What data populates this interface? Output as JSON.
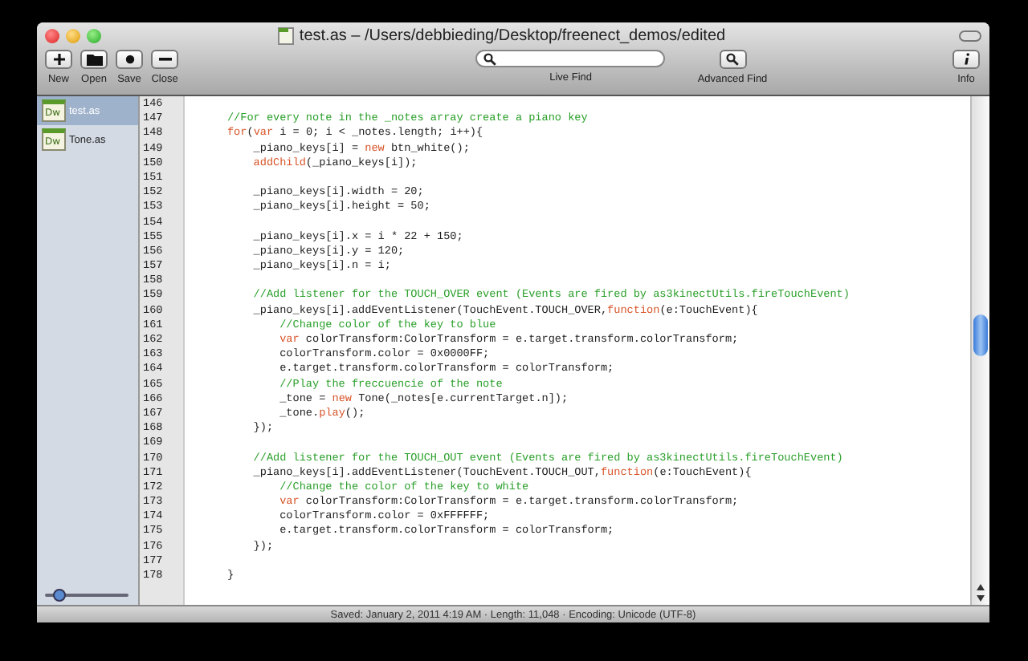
{
  "window": {
    "title": "test.as – /Users/debbieding/Desktop/freenect_demos/edited"
  },
  "toolbar": {
    "buttons": [
      {
        "kind": "new",
        "label": "New"
      },
      {
        "kind": "open",
        "label": "Open"
      },
      {
        "kind": "save",
        "label": "Save"
      },
      {
        "kind": "close",
        "label": "Close"
      }
    ],
    "search": {
      "label": "Live Find"
    },
    "advanced_find": {
      "label": "Advanced Find"
    },
    "info": {
      "label": "Info"
    }
  },
  "sidebar": {
    "items": [
      {
        "icon_text": "Dw",
        "label": "test.as",
        "selected": true
      },
      {
        "icon_text": "Dw",
        "label": "Tone.as",
        "selected": false
      }
    ],
    "slider": {
      "level": 0.15
    }
  },
  "editor": {
    "lines": [
      {
        "n": "146"
      },
      {
        "n": "147",
        "code": [
          {
            "kind": "comment",
            "text": "      //For every note in the _notes array create a piano key"
          }
        ]
      },
      {
        "n": "148",
        "code": [
          {
            "kind": "keyword",
            "text": "      for"
          },
          {
            "kind": "plain",
            "text": "("
          },
          {
            "kind": "keyword",
            "text": "var"
          },
          {
            "kind": "plain",
            "text": " i = 0; i < _notes.length; i++){"
          }
        ]
      },
      {
        "n": "149",
        "code": [
          {
            "kind": "plain",
            "text": "          _piano_keys[i] = "
          },
          {
            "kind": "keyword",
            "text": "new"
          },
          {
            "kind": "plain",
            "text": " btn_white();"
          }
        ]
      },
      {
        "n": "150",
        "code": [
          {
            "kind": "keyword",
            "text": "          addChild"
          },
          {
            "kind": "plain",
            "text": "(_piano_keys[i]);"
          }
        ]
      },
      {
        "n": "151"
      },
      {
        "n": "152",
        "code": [
          {
            "kind": "plain",
            "text": "          _piano_keys[i].width = 20;"
          }
        ]
      },
      {
        "n": "153",
        "code": [
          {
            "kind": "plain",
            "text": "          _piano_keys[i].height = 50;"
          }
        ]
      },
      {
        "n": "154"
      },
      {
        "n": "155",
        "code": [
          {
            "kind": "plain",
            "text": "          _piano_keys[i].x = i * 22 + 150;"
          }
        ]
      },
      {
        "n": "156",
        "code": [
          {
            "kind": "plain",
            "text": "          _piano_keys[i].y = 120;"
          }
        ]
      },
      {
        "n": "157",
        "code": [
          {
            "kind": "plain",
            "text": "          _piano_keys[i].n = i;"
          }
        ]
      },
      {
        "n": "158"
      },
      {
        "n": "159",
        "code": [
          {
            "kind": "comment",
            "text": "          //Add listener for the TOUCH_OVER event (Events are fired by as3kinectUtils.fireTouchEvent)"
          }
        ]
      },
      {
        "n": "160",
        "code": [
          {
            "kind": "plain",
            "text": "          _piano_keys[i].addEventListener(TouchEvent.TOUCH_OVER,"
          },
          {
            "kind": "keyword",
            "text": "function"
          },
          {
            "kind": "plain",
            "text": "(e:TouchEvent){"
          }
        ]
      },
      {
        "n": "161",
        "code": [
          {
            "kind": "comment",
            "text": "              //Change color of the key to blue"
          }
        ]
      },
      {
        "n": "162",
        "code": [
          {
            "kind": "keyword",
            "text": "              var"
          },
          {
            "kind": "plain",
            "text": " colorTransform:ColorTransform = e.target.transform.colorTransform;"
          }
        ]
      },
      {
        "n": "163",
        "code": [
          {
            "kind": "plain",
            "text": "              colorTransform.color = 0x0000FF;"
          }
        ]
      },
      {
        "n": "164",
        "code": [
          {
            "kind": "plain",
            "text": "              e.target.transform.colorTransform = colorTransform;"
          }
        ]
      },
      {
        "n": "165",
        "code": [
          {
            "kind": "comment",
            "text": "              //Play the freccuencie of the note"
          }
        ]
      },
      {
        "n": "166",
        "code": [
          {
            "kind": "plain",
            "text": "              _tone = "
          },
          {
            "kind": "keyword",
            "text": "new"
          },
          {
            "kind": "plain",
            "text": " Tone(_notes[e.currentTarget.n]);"
          }
        ]
      },
      {
        "n": "167",
        "code": [
          {
            "kind": "plain",
            "text": "              _tone."
          },
          {
            "kind": "keyword",
            "text": "play"
          },
          {
            "kind": "plain",
            "text": "();"
          }
        ]
      },
      {
        "n": "168",
        "code": [
          {
            "kind": "plain",
            "text": "          });"
          }
        ]
      },
      {
        "n": "169"
      },
      {
        "n": "170",
        "code": [
          {
            "kind": "comment",
            "text": "          //Add listener for the TOUCH_OUT event (Events are fired by as3kinectUtils.fireTouchEvent)"
          }
        ]
      },
      {
        "n": "171",
        "code": [
          {
            "kind": "plain",
            "text": "          _piano_keys[i].addEventListener(TouchEvent.TOUCH_OUT,"
          },
          {
            "kind": "keyword",
            "text": "function"
          },
          {
            "kind": "plain",
            "text": "(e:TouchEvent){"
          }
        ]
      },
      {
        "n": "172",
        "code": [
          {
            "kind": "comment",
            "text": "              //Change the color of the key to white"
          }
        ]
      },
      {
        "n": "173",
        "code": [
          {
            "kind": "keyword",
            "text": "              var"
          },
          {
            "kind": "plain",
            "text": " colorTransform:ColorTransform = e.target.transform.colorTransform;"
          }
        ]
      },
      {
        "n": "174",
        "code": [
          {
            "kind": "plain",
            "text": "              colorTransform.color = 0xFFFFFF;"
          }
        ]
      },
      {
        "n": "175",
        "code": [
          {
            "kind": "plain",
            "text": "              e.target.transform.colorTransform = colorTransform;"
          }
        ]
      },
      {
        "n": "176",
        "code": [
          {
            "kind": "plain",
            "text": "          });"
          }
        ]
      },
      {
        "n": "177"
      },
      {
        "n": "178",
        "code": [
          {
            "kind": "plain",
            "text": "      }"
          }
        ]
      }
    ]
  },
  "status_bar": {
    "text": "Saved: January 2, 2011 4:19 AM · Length: 11,048 · Encoding: Unicode (UTF-8)"
  }
}
